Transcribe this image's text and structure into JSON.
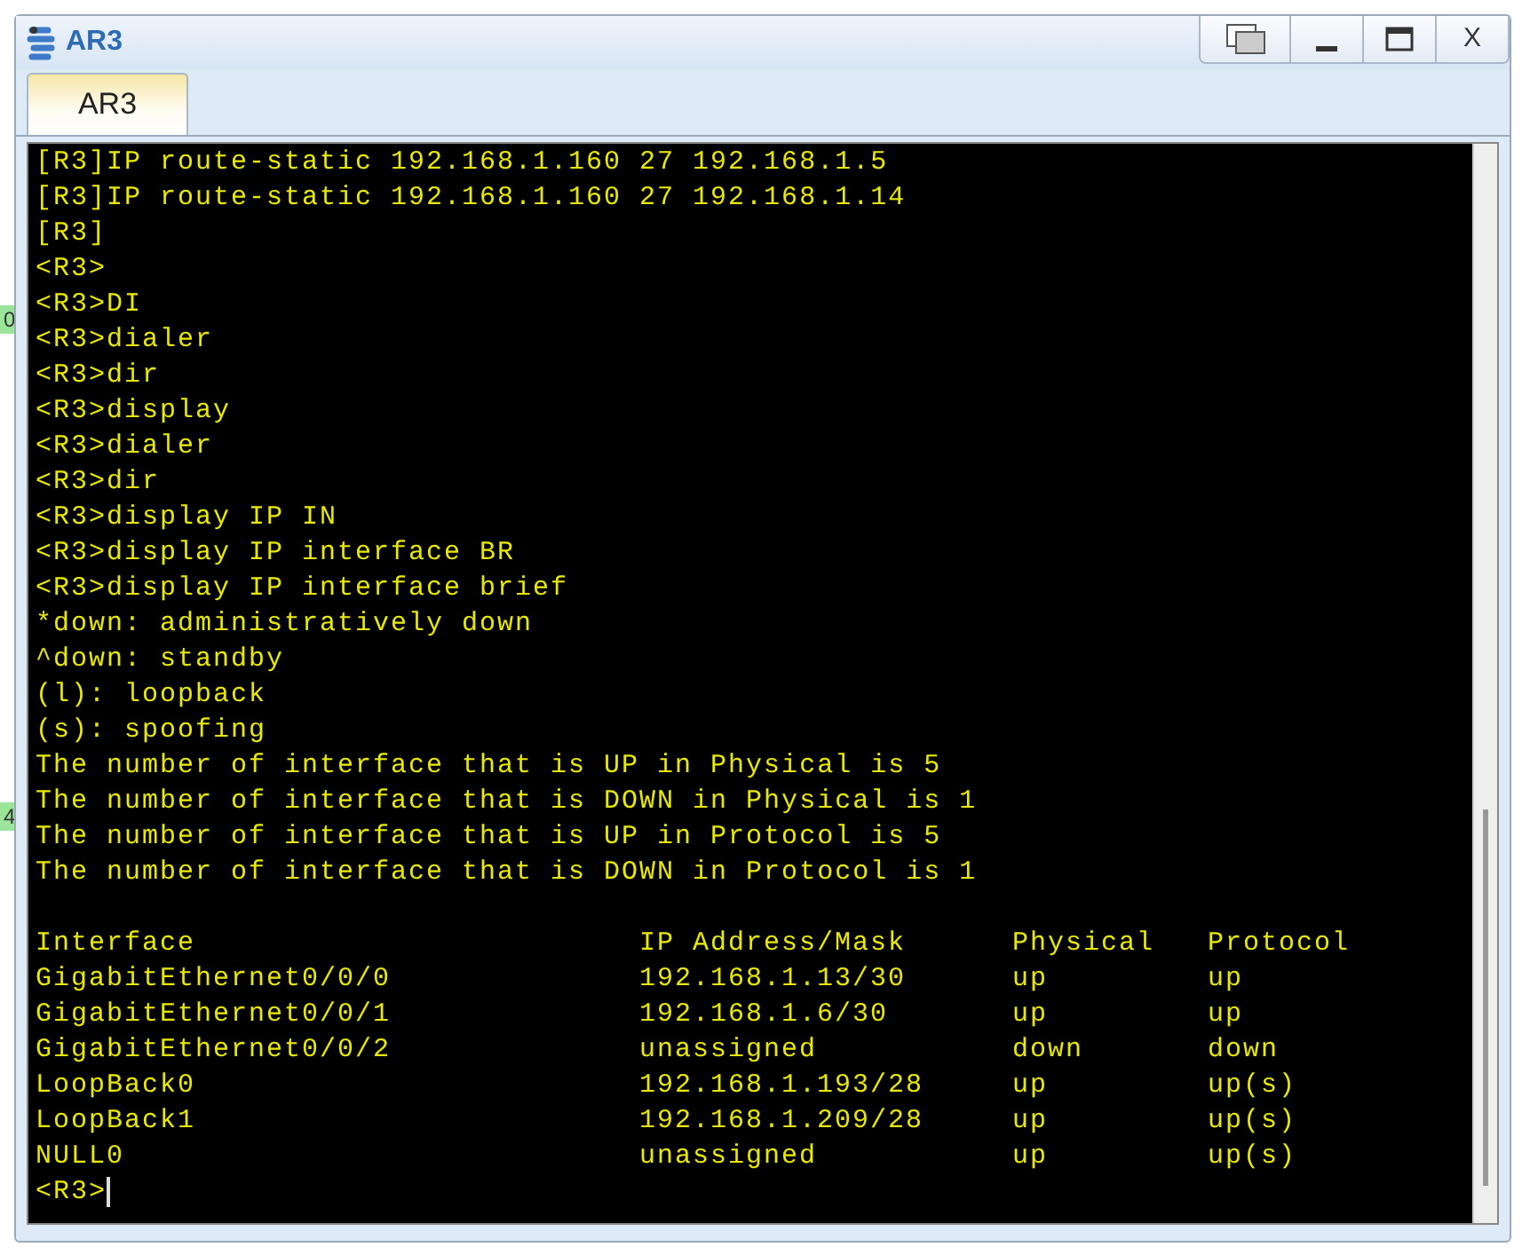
{
  "background_labels": [
    "0",
    "4"
  ],
  "window": {
    "title": "AR3",
    "controls": [
      {
        "kind": "restore"
      },
      {
        "kind": "minimize"
      },
      {
        "kind": "maximize"
      },
      {
        "kind": "close",
        "label": "X"
      }
    ]
  },
  "tabs": [
    {
      "label": "AR3",
      "selected": true
    }
  ],
  "console": {
    "lines": [
      "[R3]IP route-static 192.168.1.160 27 192.168.1.5",
      "[R3]IP route-static 192.168.1.160 27 192.168.1.14",
      "[R3]",
      "<R3>",
      "<R3>DI",
      "<R3>dialer",
      "<R3>dir",
      "<R3>display",
      "<R3>dialer",
      "<R3>dir",
      "<R3>display IP IN",
      "<R3>display IP interface BR",
      "<R3>display IP interface brief",
      "*down: administratively down",
      "^down: standby",
      "(l): loopback",
      "(s): spoofing",
      "The number of interface that is UP in Physical is 5",
      "The number of interface that is DOWN in Physical is 1",
      "The number of interface that is UP in Protocol is 5",
      "The number of interface that is DOWN in Protocol is 1"
    ],
    "table": {
      "columns": [
        "Interface",
        "IP Address/Mask",
        "Physical",
        "Protocol"
      ],
      "rows": [
        [
          "GigabitEthernet0/0/0",
          "192.168.1.13/30",
          "up",
          "up"
        ],
        [
          "GigabitEthernet0/0/1",
          "192.168.1.6/30",
          "up",
          "up"
        ],
        [
          "GigabitEthernet0/0/2",
          "unassigned",
          "down",
          "down"
        ],
        [
          "LoopBack0",
          "192.168.1.193/28",
          "up",
          "up(s)"
        ],
        [
          "LoopBack1",
          "192.168.1.209/28",
          "up",
          "up(s)"
        ],
        [
          "NULL0",
          "unassigned",
          "up",
          "up(s)"
        ]
      ]
    },
    "prompt": "<R3>"
  }
}
